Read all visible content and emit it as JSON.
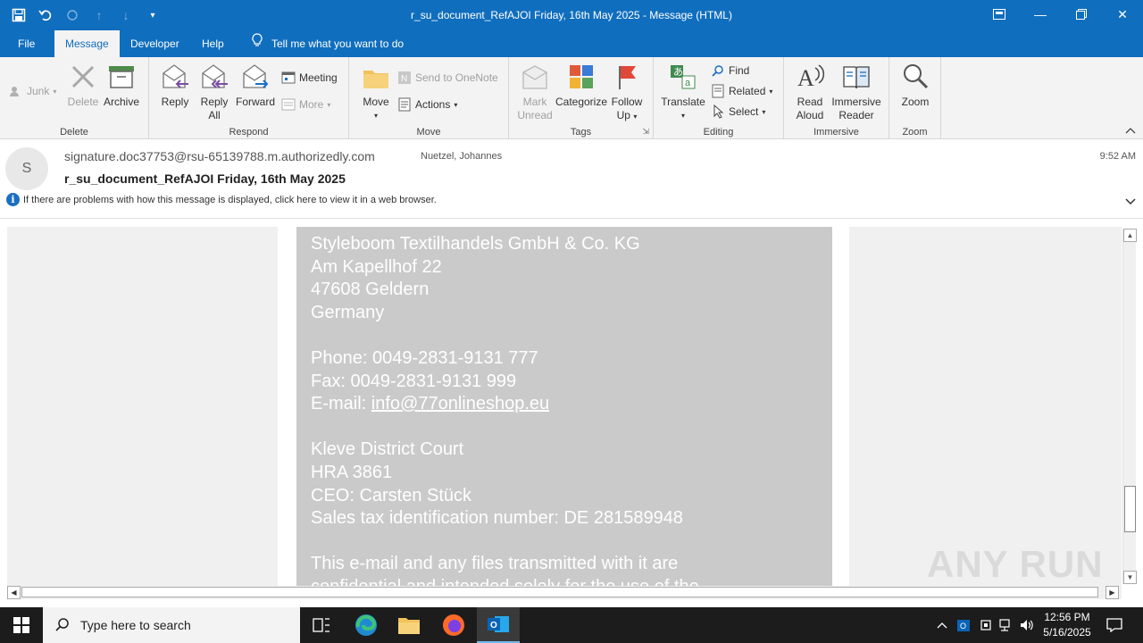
{
  "window": {
    "title": "r_su_document_RefAJOI Friday, 16th May 2025  -  Message (HTML)"
  },
  "tabs": [
    "File",
    "Message",
    "Developer",
    "Help"
  ],
  "tell_me": "Tell me what you want to do",
  "ribbon": {
    "delete_group": {
      "label": "Delete",
      "junk": "Junk",
      "delete": "Delete",
      "archive": "Archive"
    },
    "respond_group": {
      "label": "Respond",
      "reply": "Reply",
      "reply_all_1": "Reply",
      "reply_all_2": "All",
      "forward": "Forward",
      "meeting": "Meeting",
      "more": "More"
    },
    "move_group": {
      "label": "Move",
      "move": "Move",
      "send_onenote": "Send to OneNote",
      "actions": "Actions"
    },
    "tags_group": {
      "label": "Tags",
      "mark_unread_1": "Mark",
      "mark_unread_2": "Unread",
      "categorize": "Categorize",
      "follow_up_1": "Follow",
      "follow_up_2": "Up"
    },
    "editing_group": {
      "label": "Editing",
      "translate": "Translate",
      "find": "Find",
      "related": "Related",
      "select": "Select"
    },
    "immersive_group": {
      "label": "Immersive",
      "read_aloud_1": "Read",
      "read_aloud_2": "Aloud",
      "immersive_reader_1": "Immersive",
      "immersive_reader_2": "Reader"
    },
    "zoom_group": {
      "label": "Zoom",
      "zoom": "Zoom"
    }
  },
  "message": {
    "avatar_initial": "S",
    "sender": "signature.doc37753@rsu-65139788.m.authorizedly.com",
    "to": "Nuetzel, Johannes",
    "time": "9:52 AM",
    "subject": "r_su_document_RefAJOI Friday, 16th May 2025",
    "info": "If there are problems with how this message is displayed, click here to view it in a web browser."
  },
  "body": {
    "company": "Styleboom Textilhandels GmbH & Co. KG",
    "street": "Am Kapellhof 22",
    "city": "47608 Geldern",
    "country": "Germany",
    "phone": "Phone: 0049-2831-9131 777",
    "fax": "Fax: 0049-2831-9131 999",
    "email_label": "E-mail: ",
    "email": "info@77onlineshop.eu",
    "court": "Kleve District Court",
    "hra": "HRA 3861",
    "ceo": "CEO: Carsten Stück",
    "vat": "Sales tax identification number: DE 281589948",
    "disclaimer": "This e-mail and any files transmitted with it are",
    "disclaimer2": "confidential and intended solely for the use of the"
  },
  "watermark": "ANY RUN",
  "taskbar": {
    "search_placeholder": "Type here to search",
    "time": "12:56 PM",
    "date": "5/16/2025"
  },
  "colors": {
    "accent": "#106ebe",
    "body_bg": "#cacaca",
    "taskbar": "#1c1c1c"
  }
}
